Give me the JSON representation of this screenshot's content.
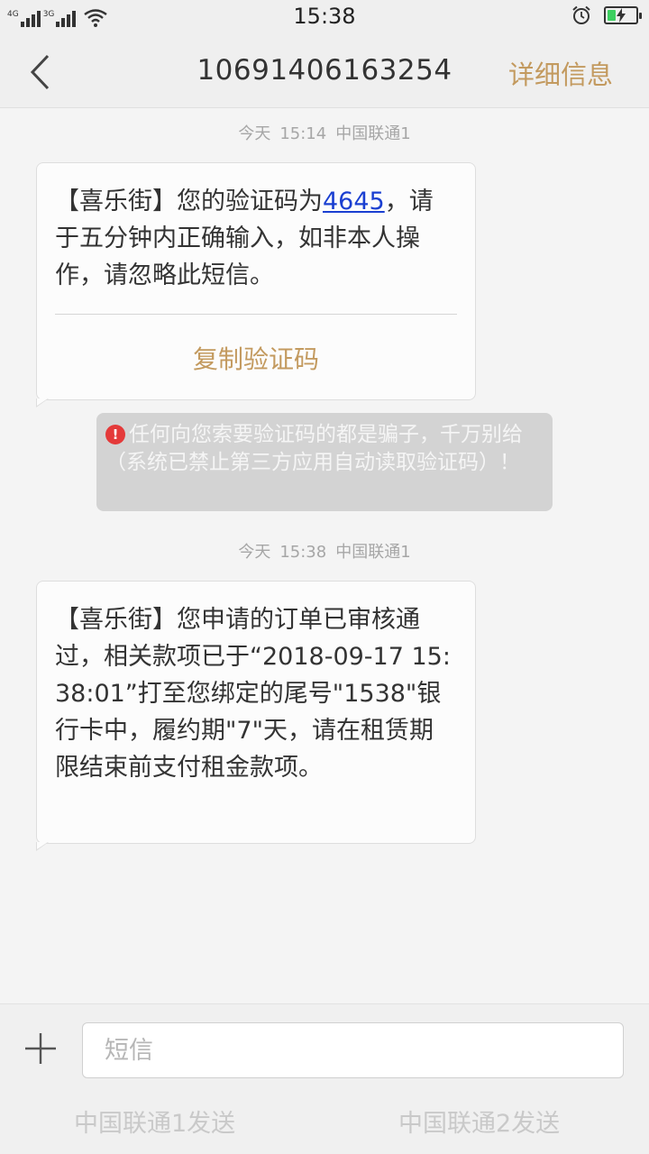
{
  "status_bar": {
    "net1": "4G",
    "net2": "3G",
    "time": "15:38"
  },
  "header": {
    "title": "10691406163254",
    "detail_label": "详细信息"
  },
  "messages": [
    {
      "timestamp": {
        "day": "今天",
        "time": "15:14",
        "sim": "中国联通1"
      },
      "text_before": "【喜乐街】您的验证码为",
      "code": "4645",
      "text_after": "，请于五分钟内正确输入，如非本人操作，请忽略此短信。",
      "copy_label": "复制验证码"
    },
    {
      "timestamp": {
        "day": "今天",
        "time": "15:38",
        "sim": "中国联通1"
      },
      "text": "【喜乐街】您申请的订单已审核通过，相关款项已于“2018-09-17 15:38:01”打至您绑定的尾号\"1538\"银行卡中，履约期\"7\"天，请在租赁期限结束前支付租金款项。"
    }
  ],
  "warning": {
    "text": "任何向您索要验证码的都是骗子，千万别给（系统已禁止第三方应用自动读取验证码）！"
  },
  "composer": {
    "placeholder": "短信",
    "send_sim1": "中国联通1发送",
    "send_sim2": "中国联通2发送"
  },
  "colors": {
    "accent": "#c39a5f",
    "link": "#1a3fd1",
    "warning_icon": "#e43a3a",
    "battery": "#3ccf60"
  },
  "battery_level": 0.3
}
